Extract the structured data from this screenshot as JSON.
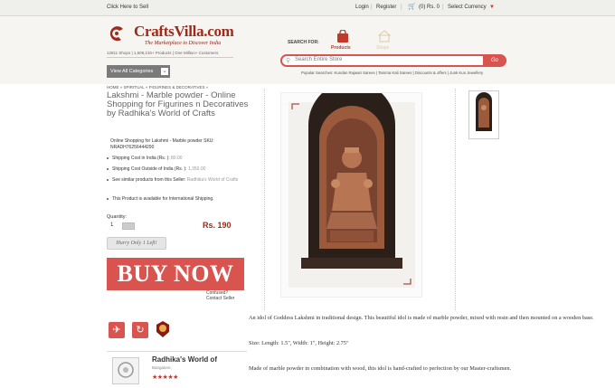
{
  "topbar": {
    "sell_link": "Click Here to Sell",
    "login": "Login",
    "register": "Register",
    "cart": "(0) Rs. 0",
    "currency": "Select Currency"
  },
  "header": {
    "logo": "CraftsVilla.com",
    "tagline": "The Marketplace to Discover India",
    "stats": "12811 Shops | 1,509,215+ Products | One Million+ Customers",
    "categories_button": "View All Categories",
    "search_for": "SEARCH FOR:",
    "tab_products": "Products",
    "tab_shops": "Shops",
    "search_placeholder": "Search Entire Store",
    "go": "Go",
    "popular": "Popular Searches: Kundan Rajwari Sarees | Tamma Kali Sarees | Discounts & offers | Junk Kun Jewellery"
  },
  "breadcrumb": "HOME  »  SPIRITUAL  »  FIGURINES & DECORATIVES  »",
  "product": {
    "title": "Lakshmi - Marble powder - Online Shopping for Figurines n Decoratives by Radhika's World of Crafts",
    "sku_text": "Online Shopping for Lakshmi - Marble powder SKU: NRADH76256444290",
    "shipping_india_label": "Shipping Cost in India (Rs. ):",
    "shipping_india_value": "80.00",
    "shipping_outside_label": "Shipping Cost Outside of India (Rs. ):",
    "shipping_outside_value": "1,350.00",
    "similar_label": "See similar products from this Seller:",
    "similar_value": "Radhika's World of Crafts",
    "international": "This Product is available for International Shipping.",
    "quantity_label": "Quantity:",
    "quantity_value": "1",
    "price": "Rs. 190",
    "hurry": "Hurry Only 1 Left!",
    "buy_now": "BUY NOW",
    "confused": "Confused?",
    "contact": "Contact Seller"
  },
  "seller": {
    "name": "Radhika's World of",
    "city": "Bangalore,",
    "stars": "★★★★★"
  },
  "description": {
    "p1": "An idol of Goddess Lakshmi in traditional design. This beautiful idol is made of marble powder, mixed with resin and then mounted on a wooden base.",
    "p2": "Size: Length: 1.5\", Width: 1\", Height: 2.75\"",
    "p3": "Made of marble powder in combination with wood, this idol is hand-crafted to perfection by our Master-craftsmen."
  }
}
